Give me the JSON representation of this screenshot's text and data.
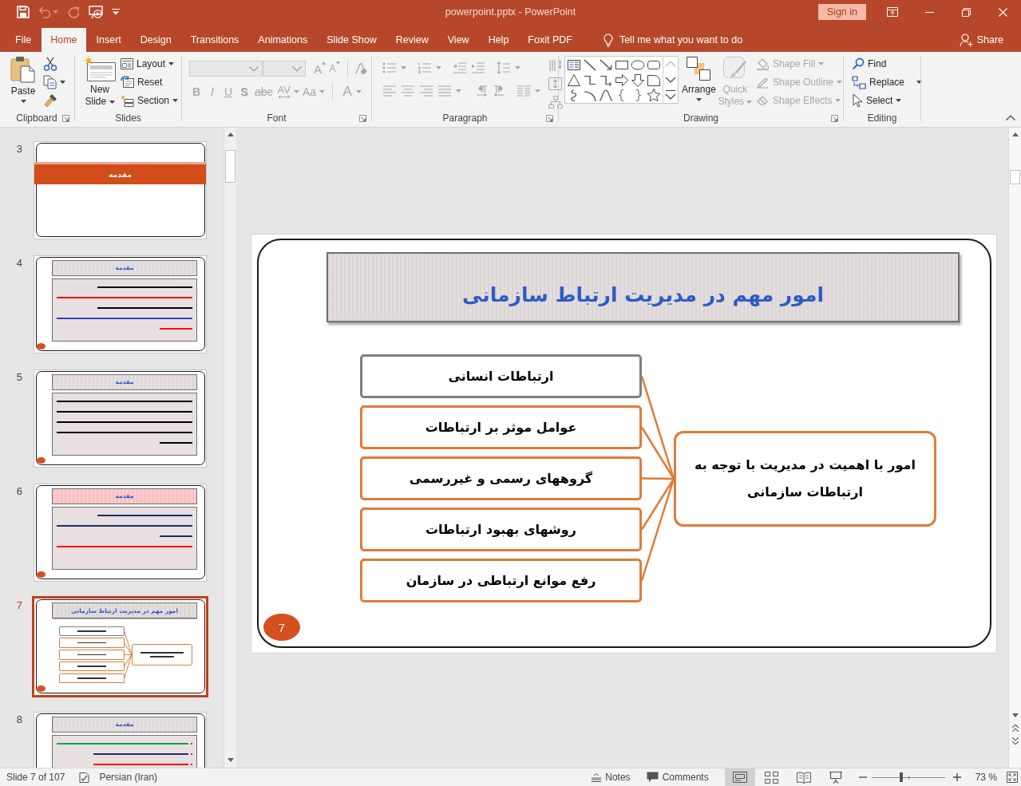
{
  "window": {
    "title": "powerpoint.pptx - PowerPoint",
    "sign_in": "Sign in"
  },
  "quick_access": [
    {
      "disabled": false
    },
    {
      "disabled": true
    },
    {
      "disabled": true
    },
    {
      "disabled": false
    }
  ],
  "tabs": [
    {
      "label": "File",
      "selected": false
    },
    {
      "label": "Home",
      "selected": true
    },
    {
      "label": "Insert",
      "selected": false
    },
    {
      "label": "Design",
      "selected": false
    },
    {
      "label": "Transitions",
      "selected": false
    },
    {
      "label": "Animations",
      "selected": false
    },
    {
      "label": "Slide Show",
      "selected": false
    },
    {
      "label": "Review",
      "selected": false
    },
    {
      "label": "View",
      "selected": false
    },
    {
      "label": "Help",
      "selected": false
    },
    {
      "label": "Foxit PDF",
      "selected": false
    }
  ],
  "tell_me": {
    "placeholder": "Tell me what you want to do"
  },
  "share": "Share",
  "ribbon": {
    "clipboard": {
      "label": "Clipboard",
      "paste": "Paste"
    },
    "slides": {
      "label": "Slides",
      "new_slide": "New Slide",
      "commands": [
        "Layout",
        "Reset",
        "Section"
      ]
    },
    "font": {
      "label": "Font",
      "disabled": true,
      "size_buttons": [
        "A",
        "A"
      ],
      "buttons": [
        "B",
        "I",
        "U",
        "S",
        "abc",
        "AV",
        "Aa",
        "A"
      ]
    },
    "paragraph": {
      "label": "Paragraph",
      "disabled": true
    },
    "drawing": {
      "label": "Drawing",
      "arrange": "Arrange",
      "quick_styles": {
        "label": "Quick Styles",
        "disabled": true
      },
      "shape_commands": [
        {
          "label": "Shape Fill",
          "disabled": true
        },
        {
          "label": "Shape Outline",
          "disabled": true
        },
        {
          "label": "Shape Effects",
          "disabled": true
        }
      ]
    },
    "editing": {
      "label": "Editing",
      "commands": [
        "Find",
        "Replace",
        "Select"
      ]
    }
  },
  "thumbnails": [
    {
      "number": "3",
      "selected": false,
      "kind": "section",
      "title": "مقدمه",
      "page_badge": false
    },
    {
      "number": "4",
      "selected": false,
      "kind": "content",
      "title": "مقدمه",
      "color": "#e6dfdf",
      "bullets": false,
      "page_badge": true,
      "text_lines": [
        {
          "kind": "part",
          "color": "#000000"
        },
        {
          "kind": "full",
          "color": "#ff0000"
        },
        {
          "kind": "part",
          "color": "#000000"
        },
        {
          "kind": "full",
          "color": "#3a3acc"
        },
        {
          "kind": "short",
          "color": "#ff0000"
        }
      ]
    },
    {
      "number": "5",
      "selected": false,
      "kind": "content",
      "title": "مقدمه",
      "color": "#e6dfdf",
      "bullets": false,
      "page_badge": true,
      "text_lines": [
        {
          "kind": "full",
          "color": "#000000"
        },
        {
          "kind": "full",
          "color": "#000000"
        },
        {
          "kind": "full",
          "color": "#000000"
        },
        {
          "kind": "full",
          "color": "#000000"
        },
        {
          "kind": "short",
          "color": "#000000"
        }
      ]
    },
    {
      "number": "6",
      "selected": false,
      "kind": "content",
      "title": "مقدمه",
      "color": "#ffc9c9",
      "bullets": false,
      "page_badge": true,
      "text_lines": [
        {
          "kind": "part",
          "color": "#1f2a6b"
        },
        {
          "kind": "full",
          "color": "#1f2a6b"
        },
        {
          "kind": "short",
          "color": "#1f2a6b"
        },
        {
          "kind": "large",
          "color": "#ff0000"
        }
      ]
    },
    {
      "number": "7",
      "selected": true,
      "kind": "diagram",
      "title": "امور مهم در مدیریت ارتباط سازمانی",
      "page_badge": true,
      "items": [
        {
          "color": "#7f7f7f"
        },
        {
          "color": "#e07b39"
        },
        {
          "color": "#e07b39"
        },
        {
          "color": "#e07b39"
        },
        {
          "color": "#e07b39"
        }
      ]
    },
    {
      "number": "8",
      "selected": false,
      "kind": "content",
      "title": "مقدمه",
      "color": "#e6dfdf",
      "bullets": true,
      "text_lines": [
        {
          "kind": "full",
          "color": "#00a651"
        },
        {
          "kind": "part",
          "color": "#1f2a6b"
        },
        {
          "kind": "part",
          "color": "#ff0000"
        }
      ]
    }
  ],
  "slide": {
    "kind": "diagram",
    "title": "امور مهم در مدیریت ارتباط سازمانی",
    "items": [
      {
        "label": "ارتباطات انسانی",
        "color": "#7f7f7f"
      },
      {
        "label": "عوامل موثر بر ارتباطات",
        "color": "#e07b39"
      },
      {
        "label": "گروههای رسمی و غیررسمی",
        "color": "#e07b39"
      },
      {
        "label": "روشهای بهبود ارتباطات",
        "color": "#e07b39"
      },
      {
        "label": "رفع موانع ارتباطی در سازمان",
        "color": "#e07b39"
      }
    ],
    "summary": "امور با اهمیت در مدیریت با توجه به ارتباطات سازمانی",
    "page_number": "7"
  },
  "status_bar": {
    "slide_info": "Slide 7 of 107",
    "language": "Persian (Iran)",
    "notes": "Notes",
    "comments": "Comments",
    "views": [
      {
        "selected": true
      },
      {
        "selected": false
      },
      {
        "selected": false
      },
      {
        "selected": false
      }
    ],
    "zoom": {
      "level": 0.4,
      "reading": "73 %"
    }
  }
}
